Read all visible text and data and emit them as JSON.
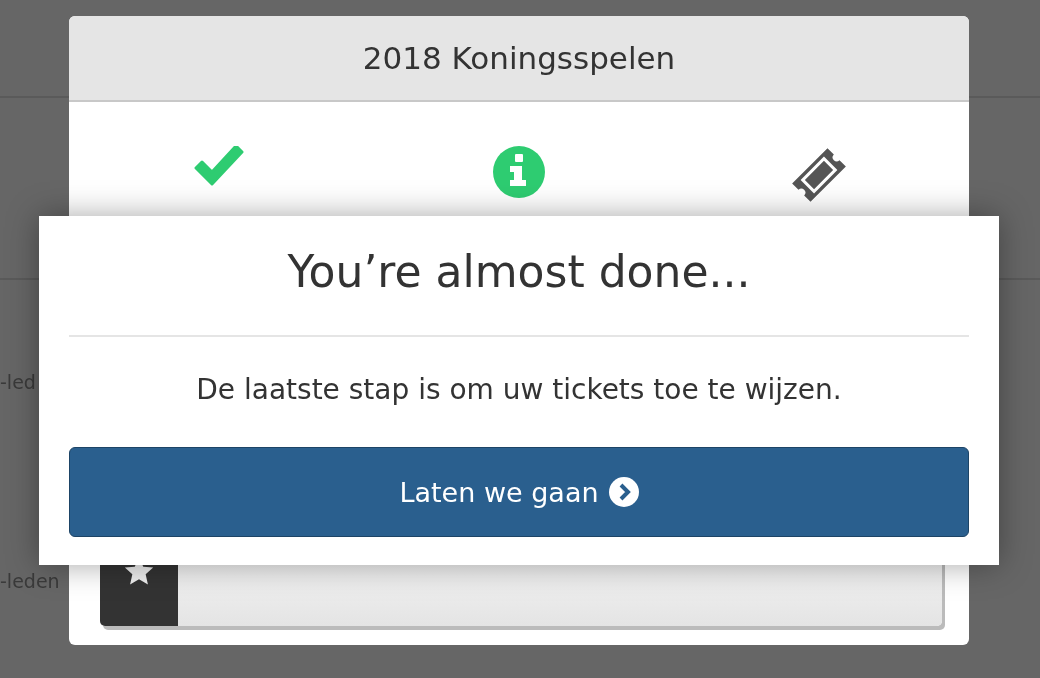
{
  "background_labels": [
    "-led",
    "-leden"
  ],
  "modal": {
    "title": "2018 Koningsspelen",
    "steps": [
      {
        "kind": "done"
      },
      {
        "kind": "current"
      },
      {
        "kind": "pending"
      }
    ]
  },
  "dialog": {
    "title": "You’re almost done...",
    "message": "De laatste stap is om uw tickets toe te wijzen.",
    "button": "Laten we gaan"
  }
}
